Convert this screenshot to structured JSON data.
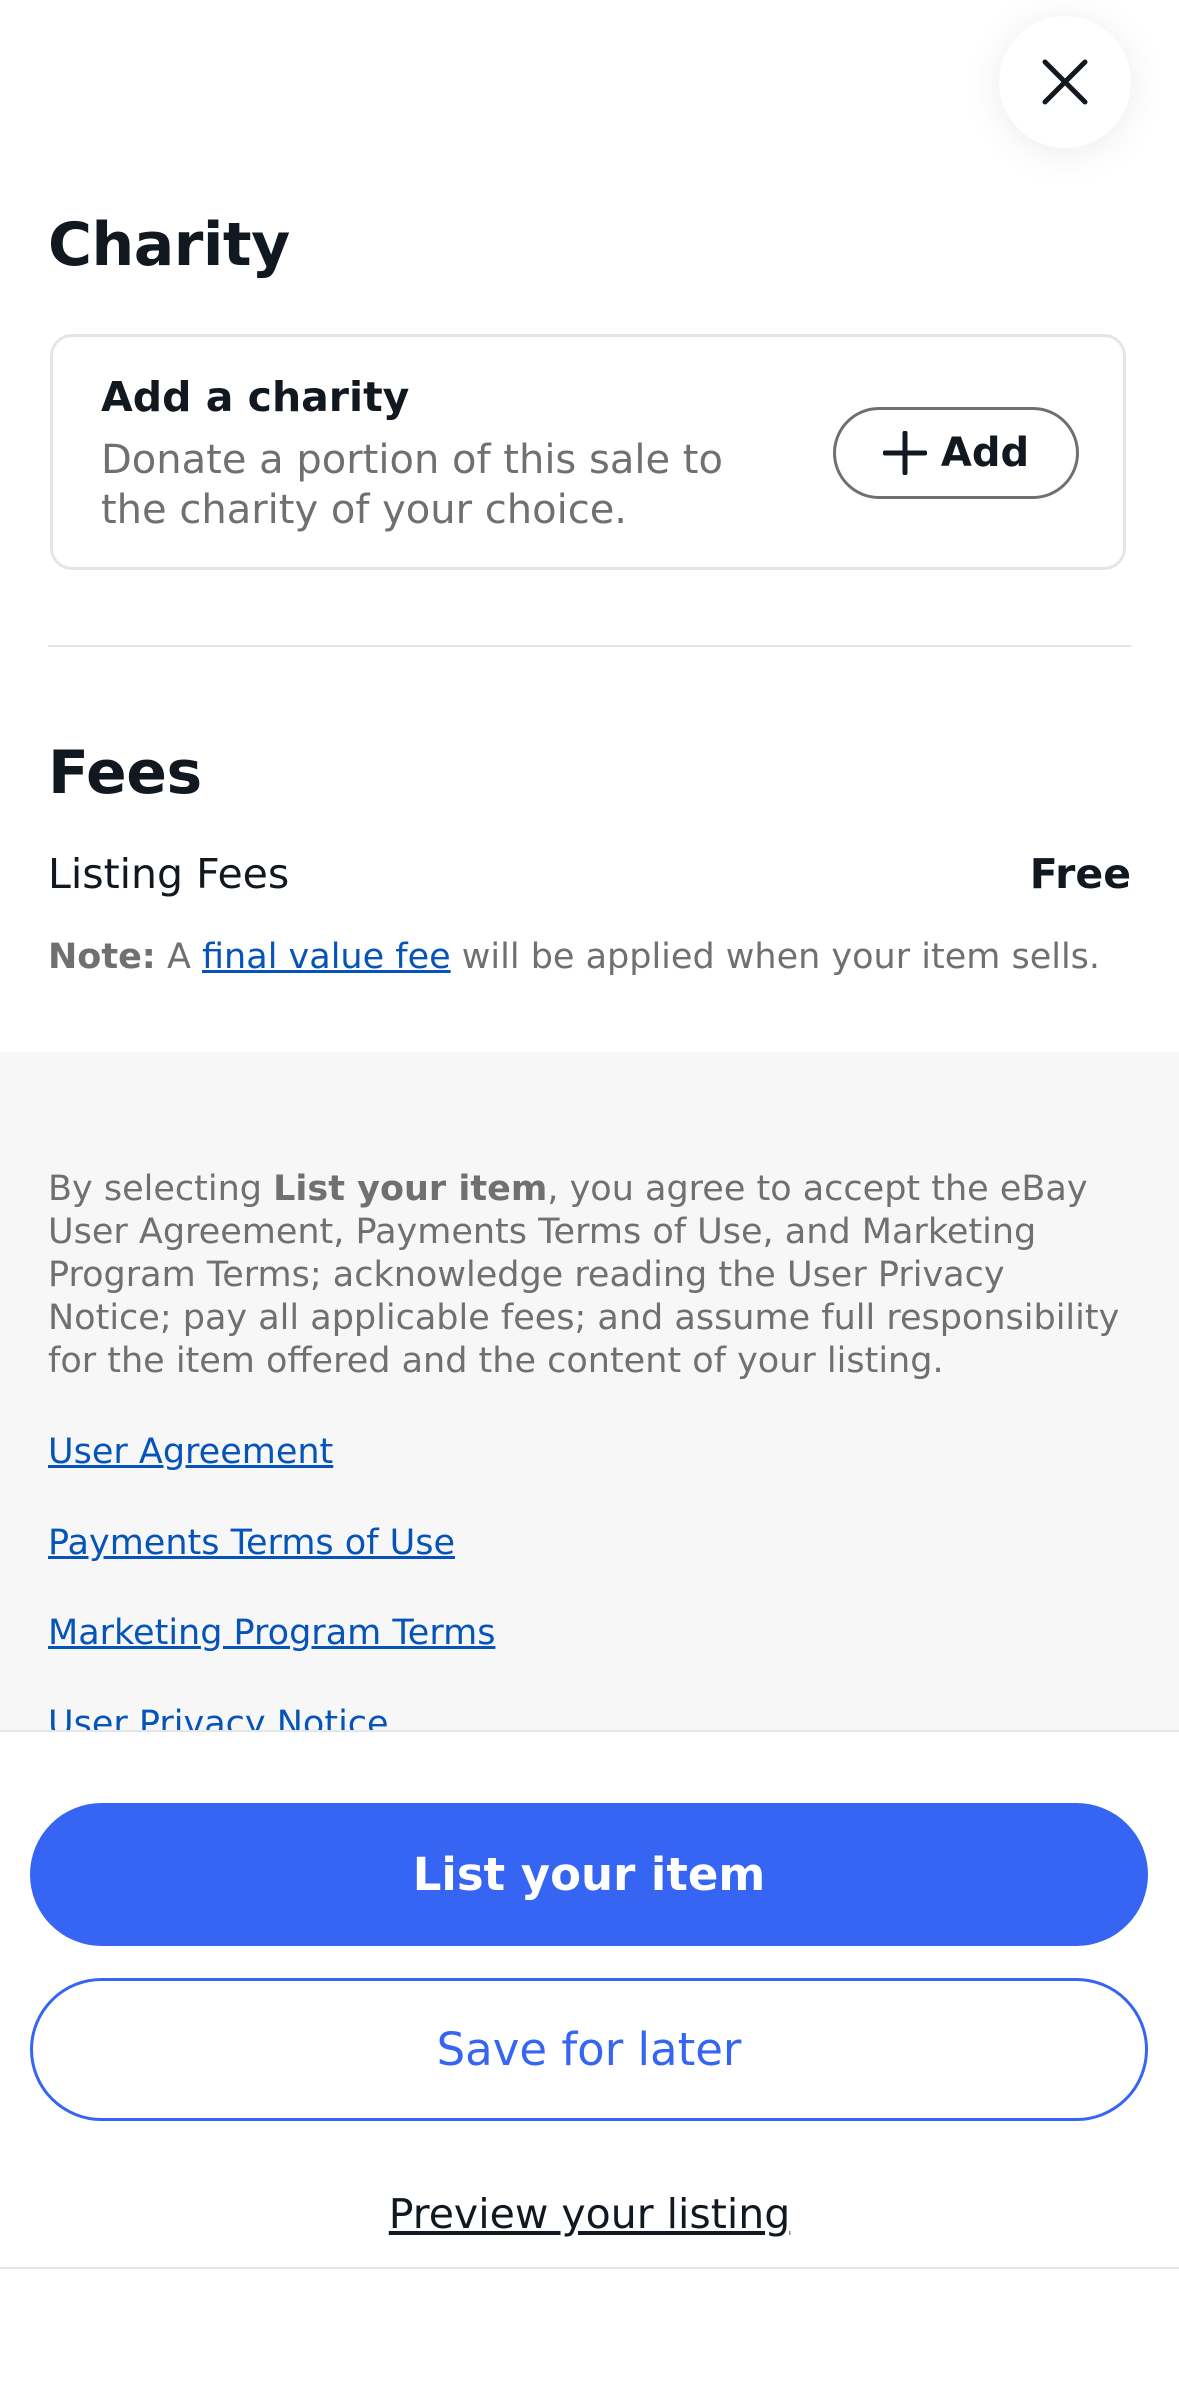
{
  "charity": {
    "title": "Charity",
    "card_title": "Add a charity",
    "card_desc": "Donate a portion of this sale to the charity of your choice.",
    "add_label": "Add"
  },
  "fees": {
    "title": "Fees",
    "listing_label": "Listing Fees",
    "listing_value": "Free",
    "note_bold": "Note:",
    "note_pre": " A ",
    "note_link": "final value fee",
    "note_post": " will be applied when your item sells."
  },
  "legal": {
    "text_pre": "By selecting ",
    "text_bold": "List your item",
    "text_post": ", you agree to accept the eBay User Agreement, Payments Terms of Use, and Marketing Program Terms; acknowledge reading the User Privacy Notice; pay all applicable fees; and assume full responsibility for the item offered and the content of your listing.",
    "links": [
      "User Agreement",
      "Payments Terms of Use",
      "Marketing Program Terms",
      "User Privacy Notice"
    ]
  },
  "actions": {
    "primary": "List your item",
    "secondary": "Save for later",
    "preview": "Preview your listing"
  },
  "colors": {
    "accent": "#3665f3",
    "link": "#0654ba",
    "muted_text": "#707070"
  },
  "icons": {
    "close": "close-icon",
    "add": "plus-icon"
  }
}
